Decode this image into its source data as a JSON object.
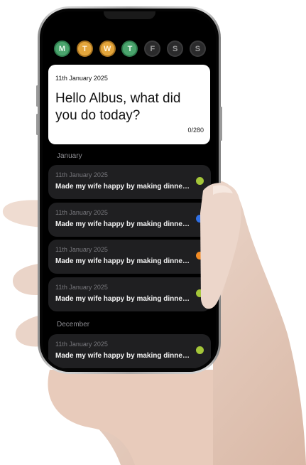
{
  "days": [
    {
      "label": "M",
      "state": "green"
    },
    {
      "label": "T",
      "state": "orange"
    },
    {
      "label": "W",
      "state": "orange"
    },
    {
      "label": "T",
      "state": "green"
    },
    {
      "label": "F",
      "state": "empty"
    },
    {
      "label": "S",
      "state": "empty"
    },
    {
      "label": "S",
      "state": "empty"
    }
  ],
  "compose": {
    "date": "11th January 2025",
    "prompt": "Hello Albus, what did you do today?",
    "counter": "0/280"
  },
  "sections": [
    {
      "month": "January",
      "entries": [
        {
          "date": "11th January 2025",
          "text": "Made my wife happy by making dinner and doing the dishes",
          "mood_color": "#a4c639"
        },
        {
          "date": "11th January 2025",
          "text": "Made my wife happy by making dinner and doing the dishes",
          "mood_color": "#2f6fe4"
        },
        {
          "date": "11th January 2025",
          "text": "Made my wife happy by making dinner and doing the dishes",
          "mood_color": "#f08a24"
        },
        {
          "date": "11th January 2025",
          "text": "Made my wife happy by making dinner and doing the dishes",
          "mood_color": "#a4c639"
        }
      ]
    },
    {
      "month": "December",
      "entries": [
        {
          "date": "11th January 2025",
          "text": "Made my wife happy by making dinner and doing the dishes",
          "mood_color": "#a4c639"
        }
      ]
    }
  ],
  "colors": {
    "green": "#4aa46d",
    "orange": "#e3a53b",
    "card_bg": "#1f1f21",
    "screen_bg": "#000000"
  }
}
